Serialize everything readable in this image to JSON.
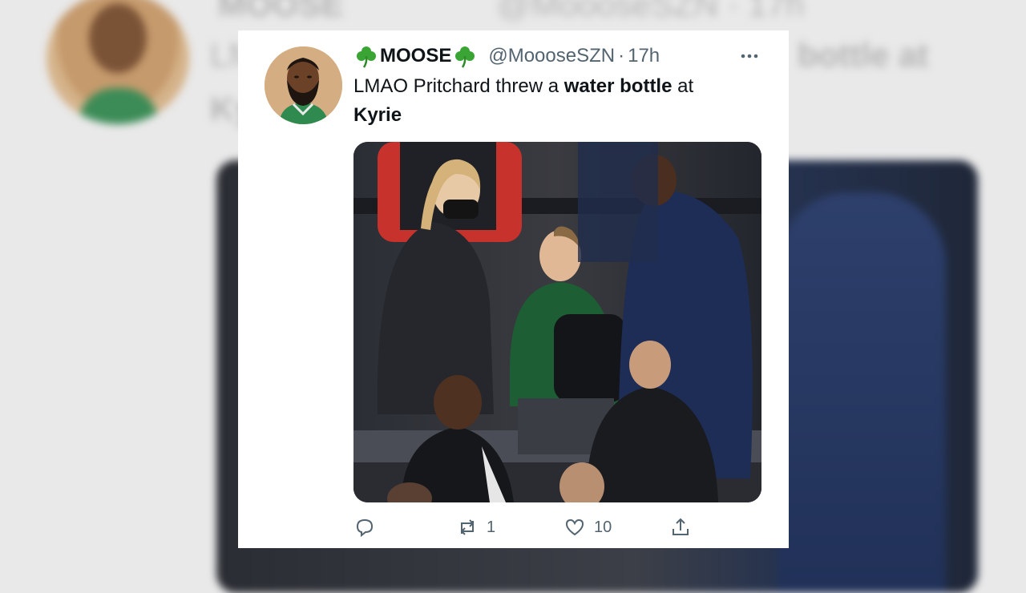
{
  "tweet": {
    "display_name": "MOOSE",
    "name_emoji": "clover-icon",
    "handle": "@MoooseSZN",
    "separator": "·",
    "time": "17h",
    "more_icon": "more-horizontal-icon",
    "text_parts": [
      {
        "text": "LMAO Pritchard threw a ",
        "bold": false
      },
      {
        "text": "water bottle",
        "bold": true
      },
      {
        "text": " at ",
        "bold": false
      },
      {
        "text": "Kyrie",
        "bold": true
      }
    ],
    "media_image": "photo-of-courtside-seats-with-player-and-staff",
    "actions": {
      "reply": {
        "icon": "reply-icon",
        "count": ""
      },
      "retweet": {
        "icon": "retweet-icon",
        "count": "1"
      },
      "like": {
        "icon": "heart-icon",
        "count": "10"
      },
      "share": {
        "icon": "share-icon",
        "count": ""
      }
    }
  },
  "background": {
    "blurred_name": "MOOSE",
    "blurred_handle": "@MoooseSZN · 17h",
    "blurred_text_left": "LM",
    "blurred_text_right": "bottle at",
    "blurred_text_left2": "Ky"
  },
  "colors": {
    "text_primary": "#0f1419",
    "text_secondary": "#536471",
    "card_background": "#ffffff",
    "clover_green": "#3aa535"
  }
}
